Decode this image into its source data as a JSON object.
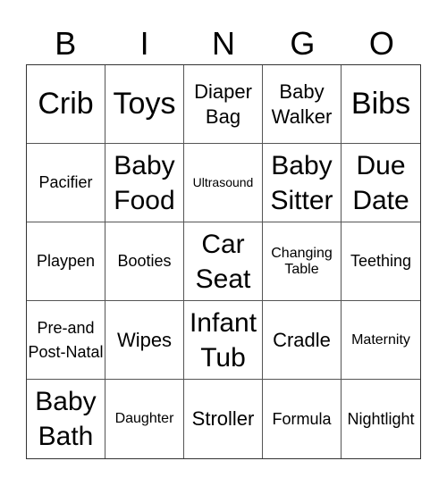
{
  "header": [
    "B",
    "I",
    "N",
    "G",
    "O"
  ],
  "cells": [
    [
      "Crib",
      "Toys",
      "Diaper Bag",
      "Baby Walker",
      "Bibs"
    ],
    [
      "Pacifier",
      "Baby Food",
      "Ultrasound",
      "Baby Sitter",
      "Due Date"
    ],
    [
      "Playpen",
      "Booties",
      "Car Seat",
      "Changing Table",
      "Teething"
    ],
    [
      "Pre-and Post-Natal",
      "Wipes",
      "Infant Tub",
      "Cradle",
      "Maternity"
    ],
    [
      "Baby Bath",
      "Daughter",
      "Stroller",
      "Formula",
      "Nightlight"
    ]
  ]
}
